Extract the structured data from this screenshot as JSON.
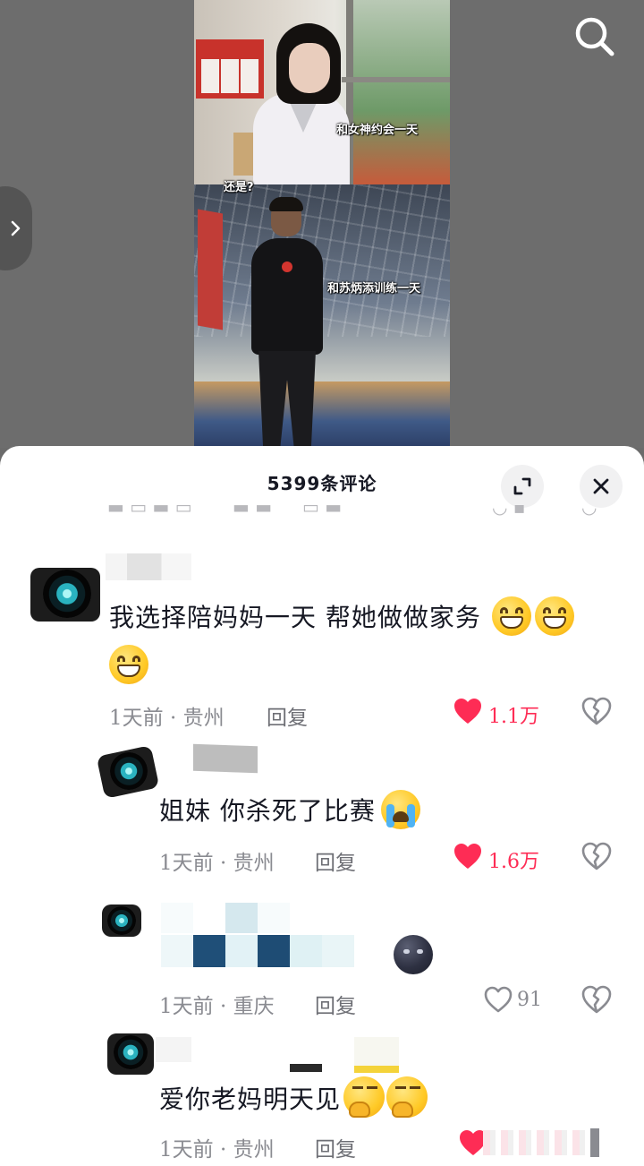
{
  "video": {
    "caption_1": "和女神约会一天",
    "caption_2": "还是?",
    "caption_3": "和苏炳添训练一天"
  },
  "comment_panel": {
    "title": "5399条评论"
  },
  "comments": [
    {
      "text": "我选择陪妈妈一天 帮她做做家务",
      "emoji": "grinning-face",
      "time": "1天前 · 贵州",
      "reply_label": "回复",
      "likes": "1.1万",
      "liked": true
    },
    {
      "text": "姐妹 你杀死了比赛",
      "emoji": "loudly-crying-face",
      "time": "1天前 · 贵州",
      "reply_label": "回复",
      "likes": "1.6万",
      "liked": true
    },
    {
      "text": "",
      "emoji": "new-moon-face",
      "time": "1天前 · 重庆",
      "reply_label": "回复",
      "likes": "91",
      "liked": false
    },
    {
      "text": "爱你老妈明天见",
      "emoji": "thinking-face",
      "time": "1天前 · 贵州",
      "reply_label": "回复",
      "liked": true
    }
  ],
  "colors": {
    "like_red": "#fe2c55",
    "meta_gray": "#8a8b91",
    "text_dark": "#161823"
  }
}
